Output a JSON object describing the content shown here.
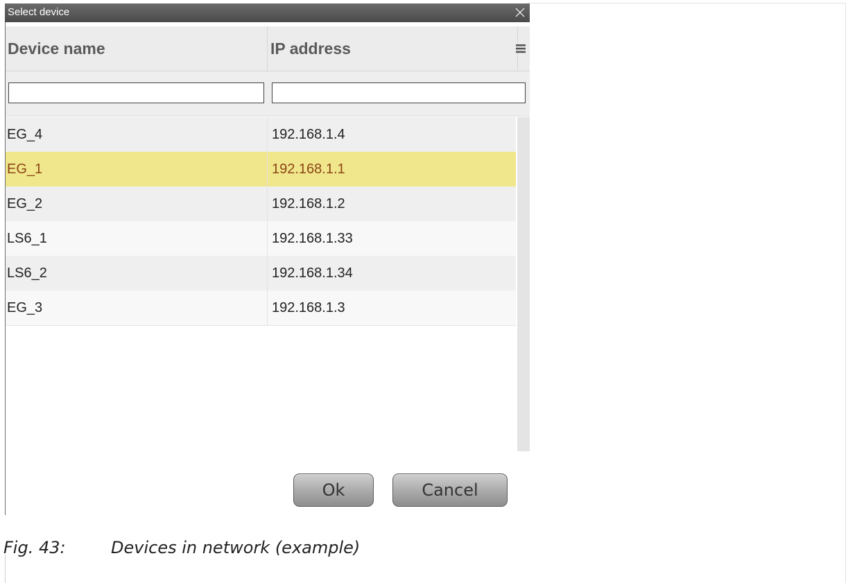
{
  "dialog": {
    "title": "Select device",
    "columns": {
      "name": "Device name",
      "ip": "IP address"
    },
    "filters": {
      "name_value": "",
      "ip_value": ""
    },
    "rows": [
      {
        "name": "EG_4",
        "ip": "192.168.1.4"
      },
      {
        "name": "EG_1",
        "ip": "192.168.1.1"
      },
      {
        "name": "EG_2",
        "ip": "192.168.1.2"
      },
      {
        "name": "LS6_1",
        "ip": "192.168.1.33"
      },
      {
        "name": "LS6_2",
        "ip": "192.168.1.34"
      },
      {
        "name": "EG_3",
        "ip": "192.168.1.3"
      }
    ],
    "selected_row": "EG_1",
    "buttons": {
      "ok": "Ok",
      "cancel": "Cancel"
    },
    "icons": {
      "close": "close-icon",
      "menu": "menu-icon"
    },
    "colors": {
      "selected_row": "#f0e68c",
      "selected_text": "#8b4513",
      "titlebar": "#555555"
    }
  },
  "caption": {
    "number": "Fig. 43:",
    "text": "Devices in network (example)"
  }
}
